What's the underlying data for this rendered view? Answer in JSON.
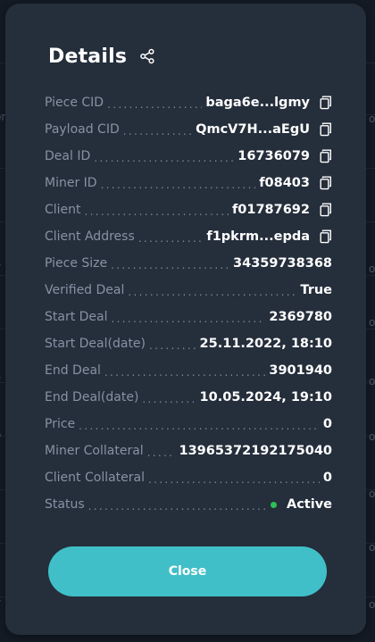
{
  "background": {
    "left_fragments": [
      "on",
      "v",
      "c",
      "v",
      "o",
      "c",
      "f",
      "y"
    ],
    "right_fragments": [
      "on",
      "on",
      "on",
      "on",
      "on",
      "on",
      "on",
      "on"
    ]
  },
  "modal": {
    "title": "Details",
    "rows": [
      {
        "label": "Piece CID",
        "value": "baga6e...lgmy",
        "copy": true
      },
      {
        "label": "Payload CID",
        "value": "QmcV7H...aEgU",
        "copy": true
      },
      {
        "label": "Deal ID",
        "value": "16736079",
        "copy": true
      },
      {
        "label": "Miner ID",
        "value": "f08403",
        "copy": true
      },
      {
        "label": "Client",
        "value": "f01787692",
        "copy": true
      },
      {
        "label": "Client Address",
        "value": "f1pkrm...epda",
        "copy": true
      },
      {
        "label": "Piece Size",
        "value": "34359738368",
        "copy": false
      },
      {
        "label": "Verified Deal",
        "value": "True",
        "copy": false
      },
      {
        "label": "Start Deal",
        "value": "2369780",
        "copy": false
      },
      {
        "label": "Start Deal(date)",
        "value": "25.11.2022, 18:10",
        "copy": false
      },
      {
        "label": "End Deal",
        "value": "3901940",
        "copy": false
      },
      {
        "label": "End Deal(date)",
        "value": "10.05.2024, 19:10",
        "copy": false
      },
      {
        "label": "Price",
        "value": "0",
        "copy": false
      },
      {
        "label": "Miner Collateral",
        "value": "13965372192175040",
        "copy": false
      },
      {
        "label": "Client Collateral",
        "value": "0",
        "copy": false
      },
      {
        "label": "Status",
        "value": "Active",
        "copy": false,
        "status": true
      }
    ],
    "close_label": "Close"
  },
  "colors": {
    "accent": "#41bfc8",
    "status_active": "#2fbf57",
    "modal_bg": "#252e3b",
    "page_bg": "#141b25"
  },
  "icons": {
    "title": "share-icon",
    "copy": "copy-icon",
    "status": "status-dot"
  }
}
